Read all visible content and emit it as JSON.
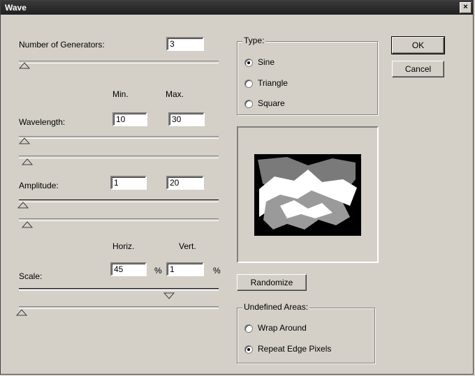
{
  "window": {
    "title": "Wave",
    "close_label": "×"
  },
  "generators": {
    "label": "Number of Generators:",
    "value": "3"
  },
  "col_headers": {
    "min": "Min.",
    "max": "Max."
  },
  "wavelength": {
    "label": "Wavelength:",
    "min": "10",
    "max": "30"
  },
  "amplitude": {
    "label": "Amplitude:",
    "min": "1",
    "max": "20"
  },
  "scale": {
    "label": "Scale:",
    "horiz_label": "Horiz.",
    "vert_label": "Vert.",
    "horiz": "45",
    "vert": "1",
    "unit": "%"
  },
  "type": {
    "legend": "Type:",
    "options": [
      "Sine",
      "Triangle",
      "Square"
    ],
    "selected": "Sine"
  },
  "buttons": {
    "ok": "OK",
    "cancel": "Cancel",
    "randomize": "Randomize"
  },
  "undefined_areas": {
    "legend": "Undefined Areas:",
    "options": [
      "Wrap Around",
      "Repeat Edge Pixels"
    ],
    "selected": "Repeat Edge Pixels"
  },
  "colors": {
    "titlebar": "#202020",
    "dialog": "#d4d0c8",
    "preview_bg": "#000000"
  }
}
